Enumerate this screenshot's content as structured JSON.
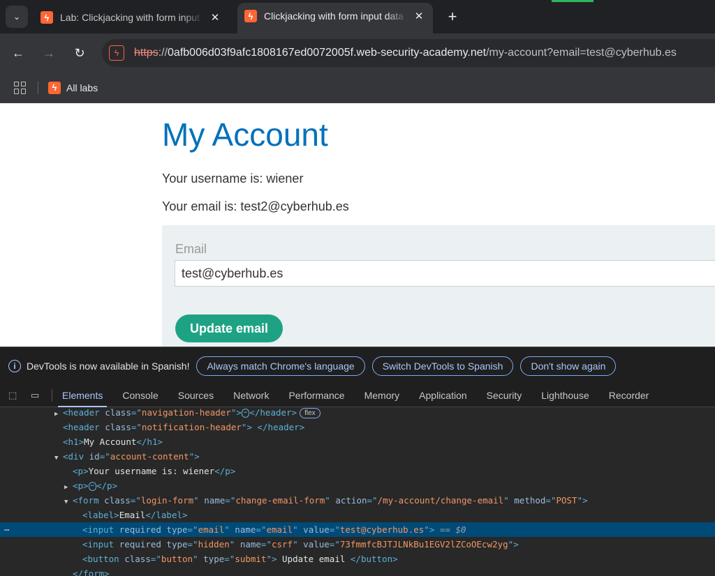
{
  "browser": {
    "tabs": [
      {
        "title": "Lab: Clickjacking with form input data prefilling",
        "active": false
      },
      {
        "title": "Clickjacking with form input data prefilling",
        "active": true
      }
    ],
    "new_tab": "+",
    "close_glyph": "✕",
    "url": {
      "scheme": "https",
      "separator": "://",
      "host": "0afb006d03f9afc1808167ed0072005f.web-security-academy.net",
      "path": "/my-account?email=test@cyberhub.es"
    },
    "bookmarks": [
      {
        "label": "All labs"
      }
    ],
    "accent_color": "#ff6633"
  },
  "page": {
    "heading": "My Account",
    "username_line": "Your username is: wiener",
    "email_line": "Your email is: test2@cyberhub.es",
    "form": {
      "label": "Email",
      "email_value": "test@cyberhub.es",
      "button": "Update email"
    },
    "colors": {
      "heading": "#0071bc",
      "button": "#1da383"
    }
  },
  "devtools": {
    "infobar": {
      "message": "DevTools is now available in Spanish!",
      "buttons": [
        "Always match Chrome's language",
        "Switch DevTools to Spanish",
        "Don't show again"
      ]
    },
    "tabs": [
      "Elements",
      "Console",
      "Sources",
      "Network",
      "Performance",
      "Memory",
      "Application",
      "Security",
      "Lighthouse",
      "Recorder"
    ],
    "active_tab": "Elements",
    "dom": {
      "nav_header_class": "navigation-header",
      "flex_badge": "flex",
      "notif_header_class": "notification-header",
      "h1_text": "My Account",
      "div_id": "account-content",
      "p_text": "Your username is: wiener",
      "form_class": "login-form",
      "form_name": "change-email-form",
      "form_action": "/my-account/change-email",
      "form_method": "POST",
      "label_text": "Email",
      "input_type": "email",
      "input_name": "email",
      "input_value": "test@cyberhub.es",
      "selected_marker": "== $0",
      "hidden_type": "hidden",
      "hidden_name": "csrf",
      "hidden_value": "73fmmfcBJTJLNkBu1EGV2lZCoOEcw2yg",
      "button_class": "button",
      "button_type": "submit",
      "button_text": " Update email "
    }
  }
}
